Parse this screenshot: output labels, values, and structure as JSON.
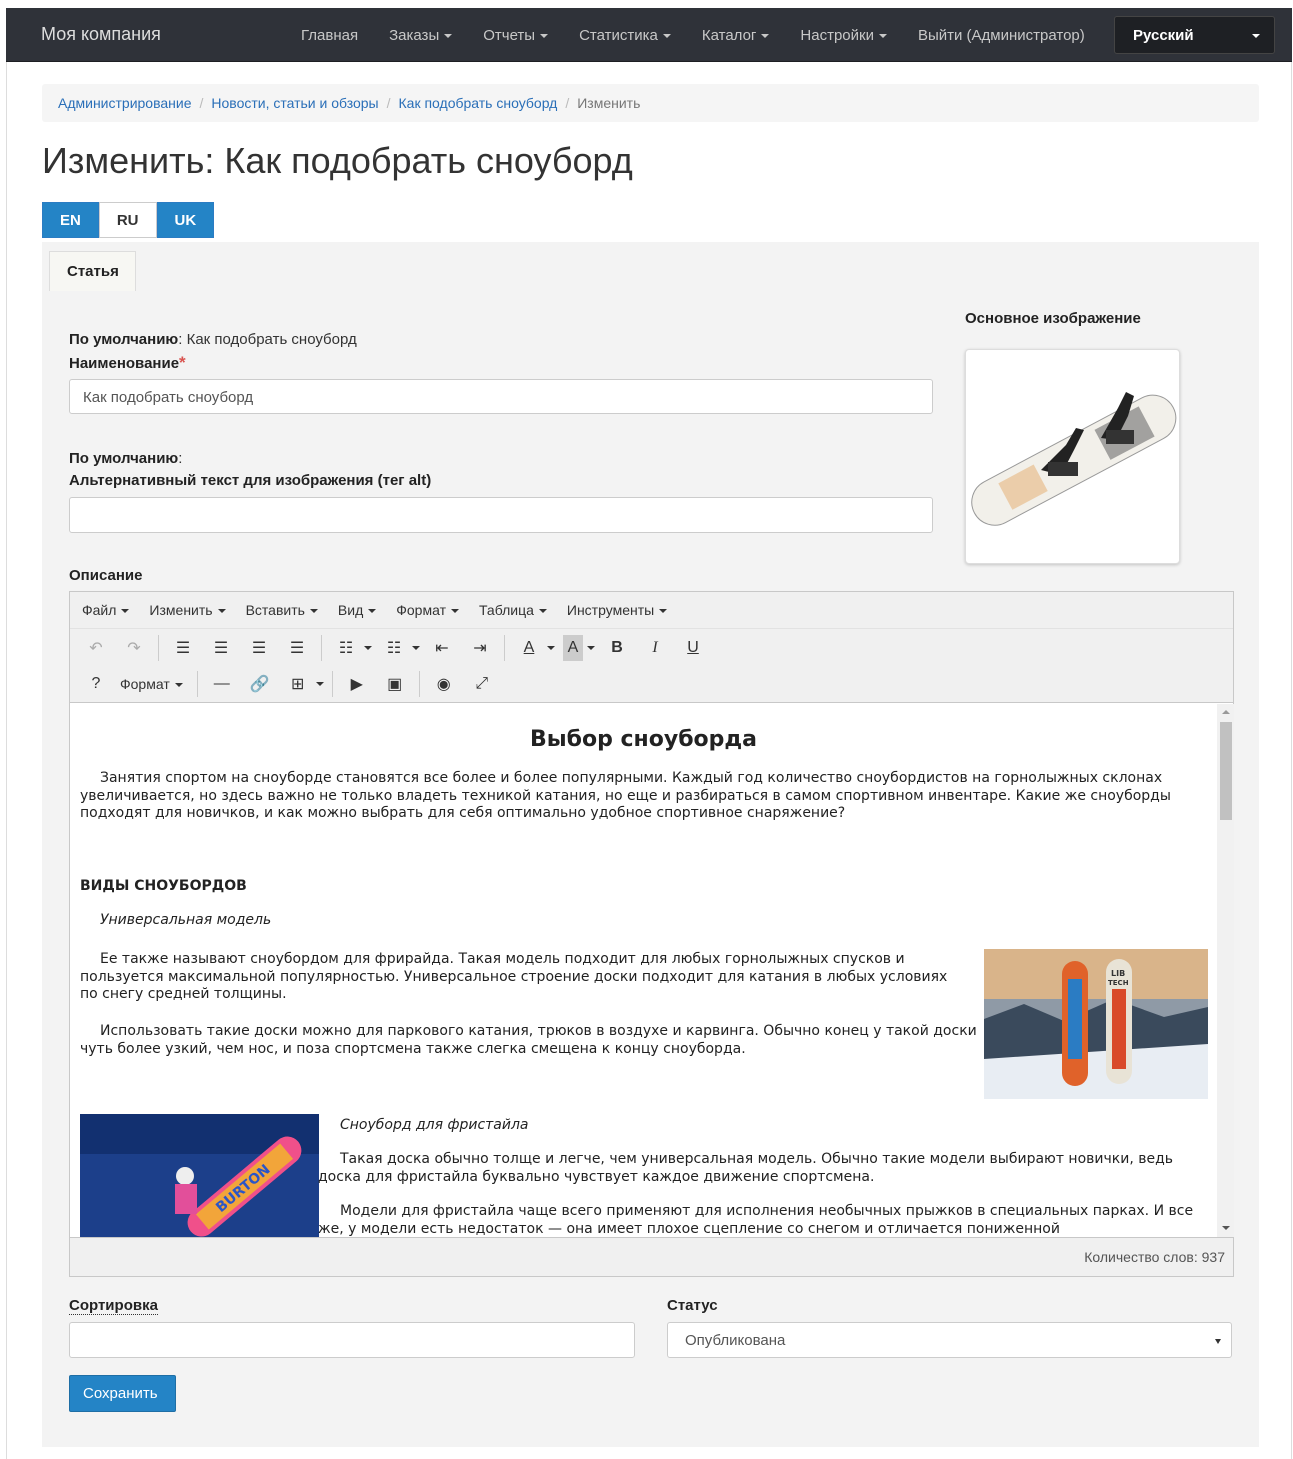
{
  "navbar": {
    "brand": "Моя компания",
    "links": [
      {
        "label": "Главная",
        "dropdown": false
      },
      {
        "label": "Заказы",
        "dropdown": true
      },
      {
        "label": "Отчеты",
        "dropdown": true
      },
      {
        "label": "Статистика",
        "dropdown": true
      },
      {
        "label": "Каталог",
        "dropdown": true
      },
      {
        "label": "Настройки",
        "dropdown": true
      },
      {
        "label": "Выйти (Администратор)",
        "dropdown": false
      }
    ],
    "language": "Русский"
  },
  "breadcrumb": {
    "items": [
      "Администрирование",
      "Новости, статьи и обзоры",
      "Как подобрать сноуборд"
    ],
    "current": "Изменить"
  },
  "page_title": "Изменить: Как подобрать сноуборд",
  "lang_tabs": [
    "EN",
    "RU",
    "UK"
  ],
  "panel_tab": "Статья",
  "form": {
    "name_default_label": "По умолчанию",
    "name_default_value": ": Как подобрать сноуборд",
    "name_label": "Наименование",
    "required_mark": "*",
    "name_value": "Как подобрать сноуборд",
    "alt_default_label": "По умолчанию",
    "alt_default_value": ":",
    "alt_label": "Альтернативный текст для изображения (тег alt)",
    "alt_value": "",
    "description_label": "Описание",
    "main_image_label": "Основное изображение",
    "sort_label": "Сортировка",
    "sort_value": "",
    "status_label": "Статус",
    "status_value": "Опубликована",
    "save_label": "Сохранить"
  },
  "editor": {
    "menu": [
      "Файл",
      "Изменить",
      "Вставить",
      "Вид",
      "Формат",
      "Таблица",
      "Инструменты"
    ],
    "format_label": "Формат",
    "word_count": "Количество слов: 937",
    "content": {
      "heading": "Выбор сноуборда",
      "intro": "Занятия спортом на сноуборде становятся все более и более популярными. Каждый год количество сноубордистов на горнолыжных склонах увеличивается, но здесь важно не только владеть техникой катания, но еще и разбираться в самом спортивном инвентаре. Какие же сноуборды подходят для новичков, и как можно выбрать для себя оптимально удобное спортивное снаряжение?",
      "section_title": "ВИДЫ СНОУБОРДОВ",
      "subtitle1": "Универсальная модель",
      "p1": "Ее также называют сноубордом для фрирайда. Такая модель подходит для любых горнолыжных спусков и пользуется максимальной популярностью. Универсальное строение доски подходит для катания в любых условиях по снегу средней толщины.",
      "p2": "Использовать такие доски можно для паркового катания, трюков в воздухе и карвинга. Обычно конец у такой доски чуть более узкий, чем нос, и поза спортсмена также слегка смещена к концу сноуборда.",
      "subtitle2": "Сноуборд для фристайла",
      "p3": "Такая доска обычно толще и легче, чем универсальная модель. Обычно такие модели выбирают новички, ведь доска для фристайла буквально чувствует каждое движение спортсмена.",
      "p4": "Модели для фристайла чаще всего применяют для исполнения необычных прыжков в специальных парках. И все же, у модели есть недостаток — она имеет плохое сцепление со снегом и отличается пониженной",
      "img1_text1": "LIB",
      "img1_text2": "TECH",
      "img2_text": "BURTON"
    }
  },
  "colors": {
    "navbar_bg": "#2f3239",
    "primary": "#2484c6",
    "link": "#2a6fb8",
    "required": "#d9534f"
  }
}
